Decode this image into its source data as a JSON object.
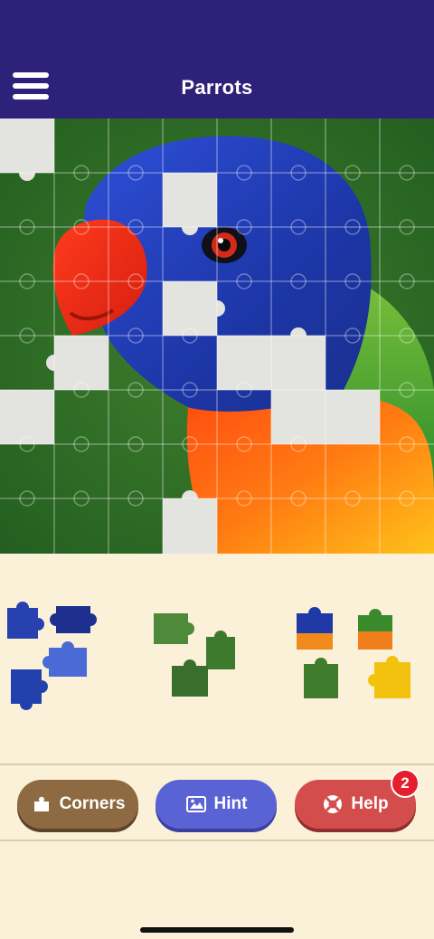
{
  "header": {
    "title": "Parrots",
    "background": "#2e2179"
  },
  "puzzle": {
    "image_subject": "rainbow-lorikeet-parrot",
    "grid_columns": 8,
    "grid_rows": 8,
    "empty_slot_color": "#e3e3df"
  },
  "tray": {
    "groups": [
      {
        "name": "blue-pieces",
        "color": "#2841b0",
        "piece_count": 4
      },
      {
        "name": "green-pieces",
        "color": "#4f8a3a",
        "piece_count": 3
      },
      {
        "name": "rainbow-pieces",
        "color": "#e78a1e",
        "piece_count": 4
      }
    ]
  },
  "toolbar": {
    "corners_label": "Corners",
    "hint_label": "Hint",
    "help_label": "Help",
    "help_badge": "2",
    "corners_color": "#8d6a42",
    "hint_color": "#5a63d3",
    "help_color": "#d44d4d",
    "icons": {
      "corners": "puzzle-corner-icon",
      "hint": "image-icon",
      "help": "lifebuoy-icon"
    }
  }
}
